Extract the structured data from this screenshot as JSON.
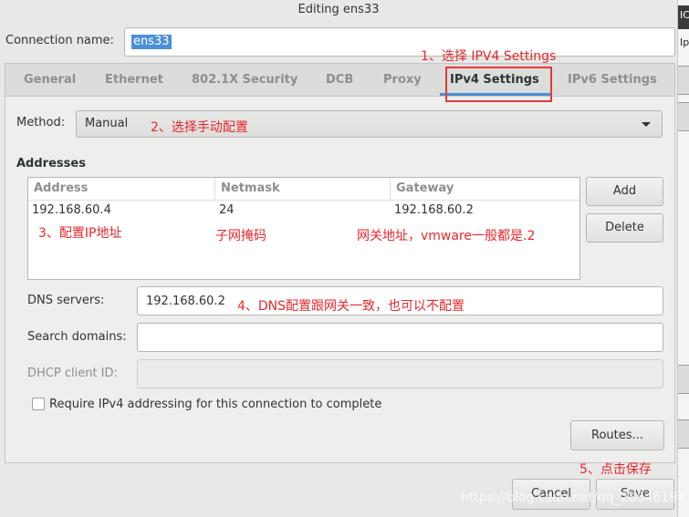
{
  "window": {
    "title": "Editing ens33"
  },
  "connection": {
    "label": "Connection name:",
    "value": "ens33"
  },
  "tabs": [
    {
      "label": "General"
    },
    {
      "label": "Ethernet"
    },
    {
      "label": "802.1X Security"
    },
    {
      "label": "DCB"
    },
    {
      "label": "Proxy"
    },
    {
      "label": "IPv4 Settings"
    },
    {
      "label": "IPv6 Settings"
    }
  ],
  "active_tab": "IPv4 Settings",
  "method": {
    "label": "Method:",
    "value": "Manual"
  },
  "addresses": {
    "heading": "Addresses",
    "columns": [
      "Address",
      "Netmask",
      "Gateway"
    ],
    "rows": [
      [
        "192.168.60.4",
        "24",
        "192.168.60.2"
      ]
    ],
    "add_label": "Add",
    "delete_label": "Delete"
  },
  "dns": {
    "label": "DNS servers:",
    "value": "192.168.60.2"
  },
  "search_domains": {
    "label": "Search domains:",
    "value": ""
  },
  "dhcp_client_id": {
    "label": "DHCP client ID:",
    "value": ""
  },
  "require_ipv4": {
    "label": "Require IPv4 addressing for this connection to complete",
    "checked": false
  },
  "routes_label": "Routes...",
  "cancel_label": "Cancel",
  "save_label": "Save",
  "annotations": {
    "a1": "1、选择 IPV4 Settings",
    "a2": "2、选择手动配置",
    "a3": "3、配置IP地址",
    "a3b": "子网掩码",
    "a3c": "网关地址，vmware一般都是.2",
    "a4": "4、DNS配置跟网关一致，也可以不配置",
    "a5": "5、点击保存"
  },
  "watermark": "https://blog.csdn.net/qq_28646197",
  "edge_glyphs": [
    "IC",
    "Ip"
  ],
  "colors": {
    "accent": "#4a90d9",
    "annotation": "#e8262b",
    "background": "#e8e8e7"
  }
}
